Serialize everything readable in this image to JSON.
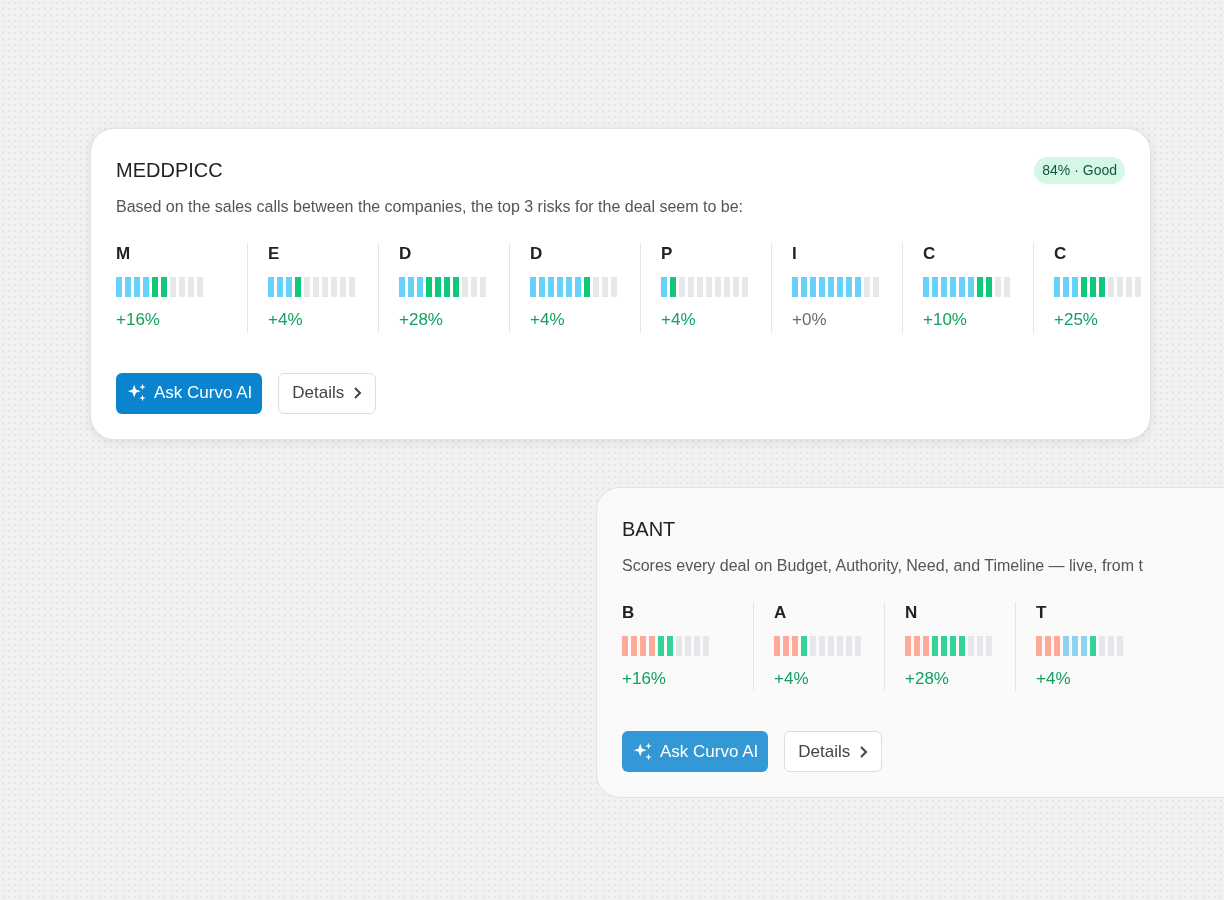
{
  "cards": [
    {
      "title": "MEDDPICC",
      "badge": "84% · Good",
      "description": "Based on the sales calls between the companies, the top 3 risks for the deal seem to be:",
      "faded": false,
      "metrics": [
        {
          "letter": "M",
          "change": "+16%",
          "neutral": false,
          "segments": [
            {
              "color": "#67d0fb"
            },
            {
              "color": "#67d0fb"
            },
            {
              "color": "#67d0fb"
            },
            {
              "color": "#67d0fb"
            },
            {
              "color": "#10c77a"
            },
            {
              "color": "#10c77a"
            },
            {
              "color": "#e5e7eb"
            },
            {
              "color": "#e5e7eb"
            },
            {
              "color": "#e5e7eb"
            },
            {
              "color": "#e5e7eb"
            }
          ]
        },
        {
          "letter": "E",
          "change": "+4%",
          "neutral": false,
          "segments": [
            {
              "color": "#67d0fb"
            },
            {
              "color": "#67d0fb"
            },
            {
              "color": "#67d0fb"
            },
            {
              "color": "#10c77a"
            },
            {
              "color": "#e5e7eb"
            },
            {
              "color": "#e5e7eb"
            },
            {
              "color": "#e5e7eb"
            },
            {
              "color": "#e5e7eb"
            },
            {
              "color": "#e5e7eb"
            },
            {
              "color": "#e5e7eb"
            }
          ]
        },
        {
          "letter": "D",
          "change": "+28%",
          "neutral": false,
          "segments": [
            {
              "color": "#67d0fb"
            },
            {
              "color": "#67d0fb"
            },
            {
              "color": "#67d0fb"
            },
            {
              "color": "#10c77a"
            },
            {
              "color": "#10c77a"
            },
            {
              "color": "#10c77a"
            },
            {
              "color": "#10c77a"
            },
            {
              "color": "#e5e7eb"
            },
            {
              "color": "#e5e7eb"
            },
            {
              "color": "#e5e7eb"
            }
          ]
        },
        {
          "letter": "D",
          "change": "+4%",
          "neutral": false,
          "segments": [
            {
              "color": "#67d0fb"
            },
            {
              "color": "#67d0fb"
            },
            {
              "color": "#67d0fb"
            },
            {
              "color": "#67d0fb"
            },
            {
              "color": "#67d0fb"
            },
            {
              "color": "#67d0fb"
            },
            {
              "color": "#10c77a"
            },
            {
              "color": "#e5e7eb"
            },
            {
              "color": "#e5e7eb"
            },
            {
              "color": "#e5e7eb"
            }
          ]
        },
        {
          "letter": "P",
          "change": "+4%",
          "neutral": false,
          "segments": [
            {
              "color": "#67d0fb"
            },
            {
              "color": "#10c77a"
            },
            {
              "color": "#e5e7eb"
            },
            {
              "color": "#e5e7eb"
            },
            {
              "color": "#e5e7eb"
            },
            {
              "color": "#e5e7eb"
            },
            {
              "color": "#e5e7eb"
            },
            {
              "color": "#e5e7eb"
            },
            {
              "color": "#e5e7eb"
            },
            {
              "color": "#e5e7eb"
            }
          ]
        },
        {
          "letter": "I",
          "change": "+0%",
          "neutral": true,
          "segments": [
            {
              "color": "#67d0fb"
            },
            {
              "color": "#67d0fb"
            },
            {
              "color": "#67d0fb"
            },
            {
              "color": "#67d0fb"
            },
            {
              "color": "#67d0fb"
            },
            {
              "color": "#67d0fb"
            },
            {
              "color": "#67d0fb"
            },
            {
              "color": "#67d0fb"
            },
            {
              "color": "#e5e7eb"
            },
            {
              "color": "#e5e7eb"
            }
          ]
        },
        {
          "letter": "C",
          "change": "+10%",
          "neutral": false,
          "segments": [
            {
              "color": "#67d0fb"
            },
            {
              "color": "#67d0fb"
            },
            {
              "color": "#67d0fb"
            },
            {
              "color": "#67d0fb"
            },
            {
              "color": "#67d0fb"
            },
            {
              "color": "#67d0fb"
            },
            {
              "color": "#10c77a"
            },
            {
              "color": "#10c77a"
            },
            {
              "color": "#e5e7eb"
            },
            {
              "color": "#e5e7eb"
            }
          ]
        },
        {
          "letter": "C",
          "change": "+25%",
          "neutral": false,
          "segments": [
            {
              "color": "#67d0fb"
            },
            {
              "color": "#67d0fb"
            },
            {
              "color": "#67d0fb"
            },
            {
              "color": "#10c77a"
            },
            {
              "color": "#10c77a"
            },
            {
              "color": "#10c77a"
            },
            {
              "color": "#e5e7eb"
            },
            {
              "color": "#e5e7eb"
            },
            {
              "color": "#e5e7eb"
            },
            {
              "color": "#e5e7eb"
            }
          ]
        }
      ],
      "buttons": [
        {
          "label": "Ask Curvo AI",
          "kind": "primary"
        },
        {
          "label": "Details",
          "kind": "secondary"
        }
      ]
    },
    {
      "title": "BANT",
      "description": "Scores every deal on Budget, Authority, Need, and Timeline — live, from t",
      "faded": true,
      "metrics": [
        {
          "letter": "B",
          "change": "+16%",
          "neutral": false,
          "segments": [
            {
              "color": "#fdab98"
            },
            {
              "color": "#fdab98"
            },
            {
              "color": "#fdab98"
            },
            {
              "color": "#fdab98"
            },
            {
              "color": "#34d399"
            },
            {
              "color": "#34d399"
            },
            {
              "color": "#e5e7eb"
            },
            {
              "color": "#e5e7eb"
            },
            {
              "color": "#e5e7eb"
            },
            {
              "color": "#e5e7eb"
            }
          ]
        },
        {
          "letter": "A",
          "change": "+4%",
          "neutral": false,
          "segments": [
            {
              "color": "#fdab98"
            },
            {
              "color": "#fdab98"
            },
            {
              "color": "#fdab98"
            },
            {
              "color": "#34d399"
            },
            {
              "color": "#e5e7eb"
            },
            {
              "color": "#e5e7eb"
            },
            {
              "color": "#e5e7eb"
            },
            {
              "color": "#e5e7eb"
            },
            {
              "color": "#e5e7eb"
            },
            {
              "color": "#e5e7eb"
            }
          ]
        },
        {
          "letter": "N",
          "change": "+28%",
          "neutral": false,
          "segments": [
            {
              "color": "#fdab98"
            },
            {
              "color": "#fdab98"
            },
            {
              "color": "#fdab98"
            },
            {
              "color": "#34d399"
            },
            {
              "color": "#34d399"
            },
            {
              "color": "#34d399"
            },
            {
              "color": "#34d399"
            },
            {
              "color": "#e5e7eb"
            },
            {
              "color": "#e5e7eb"
            },
            {
              "color": "#e5e7eb"
            }
          ]
        },
        {
          "letter": "T",
          "change": "+4%",
          "neutral": false,
          "segments": [
            {
              "color": "#fdab98"
            },
            {
              "color": "#fdab98"
            },
            {
              "color": "#fdab98"
            },
            {
              "color": "#8dd3f0"
            },
            {
              "color": "#8dd3f0"
            },
            {
              "color": "#8dd3f0"
            },
            {
              "color": "#34d399"
            },
            {
              "color": "#e5e7eb"
            },
            {
              "color": "#e5e7eb"
            },
            {
              "color": "#e5e7eb"
            }
          ]
        }
      ],
      "buttons": [
        {
          "label": "Ask Curvo AI",
          "kind": "primary"
        },
        {
          "label": "Details",
          "kind": "secondary"
        }
      ]
    }
  ]
}
